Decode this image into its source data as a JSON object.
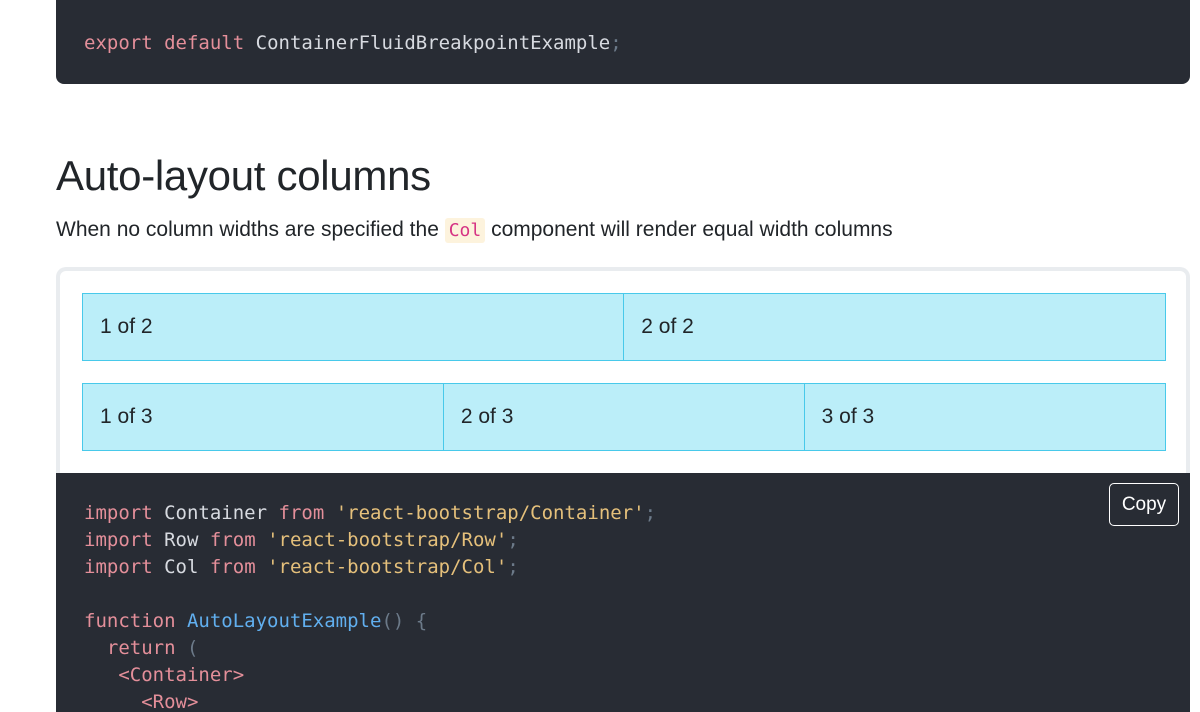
{
  "top_code": {
    "kw1": "export",
    "kw2": "default",
    "name": "ContainerFluidBreakpointExample",
    "semi": ";"
  },
  "section": {
    "title": "Auto-layout columns",
    "lead_before": "When no column widths are specified the ",
    "lead_code": "Col",
    "lead_after": " component will render equal width columns"
  },
  "example": {
    "row1": [
      "1 of 2",
      "2 of 2"
    ],
    "row2": [
      "1 of 3",
      "2 of 3",
      "3 of 3"
    ]
  },
  "code": {
    "copy_label": "Copy",
    "imports": [
      {
        "kw": "import",
        "name": "Container",
        "from": "from",
        "path": "'react-bootstrap/Container'",
        "semi": ";"
      },
      {
        "kw": "import",
        "name": "Row",
        "from": "from",
        "path": "'react-bootstrap/Row'",
        "semi": ";"
      },
      {
        "kw": "import",
        "name": "Col",
        "from": "from",
        "path": "'react-bootstrap/Col'",
        "semi": ";"
      }
    ],
    "func_kw": "function",
    "func_name": "AutoLayoutExample",
    "func_tail": "() {",
    "return_kw": "return",
    "return_paren": "(",
    "container_tag": "<Container>",
    "row_tag": "<Row>"
  }
}
